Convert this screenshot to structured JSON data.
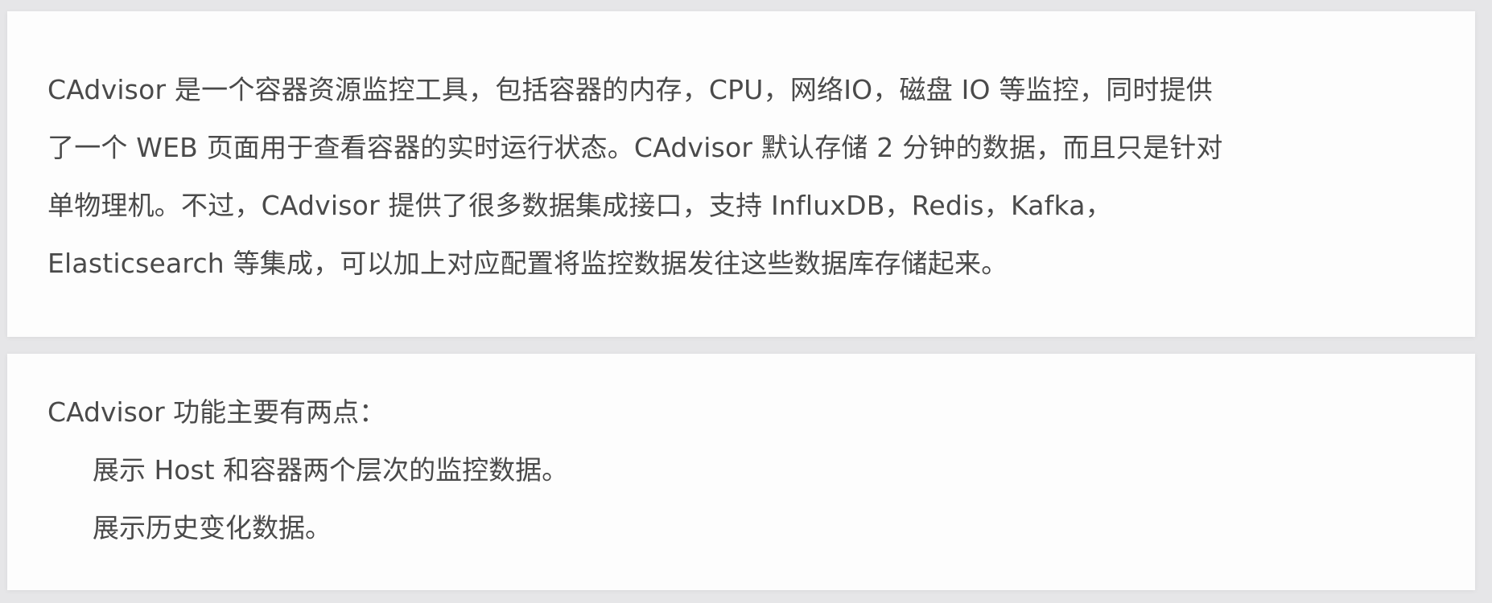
{
  "intro": {
    "lines": [
      "CAdvisor 是一个容器资源监控工具，包括容器的内存，CPU，网络IO，磁盘 IO 等监控，同时提供",
      "了一个 WEB 页面用于查看容器的实时运行状态。CAdvisor 默认存储 2 分钟的数据，而且只是针对",
      "单物理机。不过，CAdvisor 提供了很多数据集成接口，支持 InfluxDB，Redis，Kafka，",
      "Elasticsearch 等集成，可以加上对应配置将监控数据发往这些数据库存储起来。"
    ]
  },
  "features": {
    "heading": "CAdvisor 功能主要有两点：",
    "items": [
      "展示 Host 和容器两个层次的监控数据。",
      "展示历史变化数据。"
    ]
  }
}
